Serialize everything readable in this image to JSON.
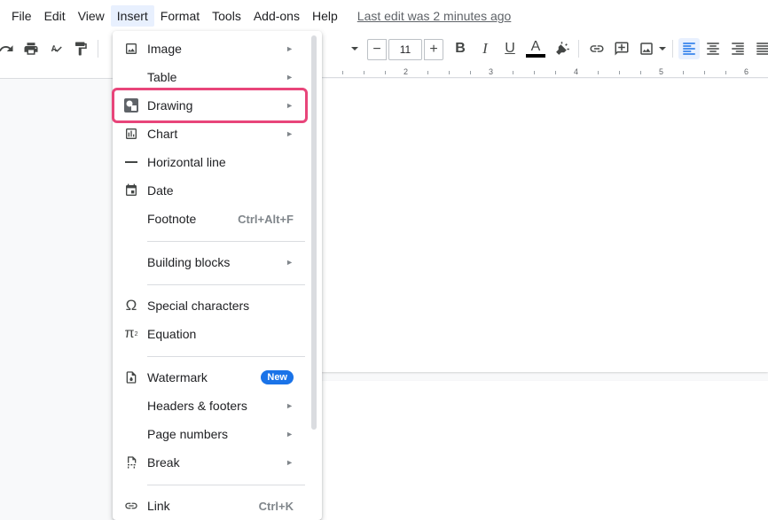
{
  "menubar": {
    "items": [
      "File",
      "Edit",
      "View",
      "Insert",
      "Format",
      "Tools",
      "Add-ons",
      "Help"
    ],
    "active_index": 3,
    "last_edit": "Last edit was 2 minutes ago"
  },
  "toolbar": {
    "font_size": "11",
    "minus_label": "−",
    "plus_label": "+",
    "bold_label": "B",
    "italic_label": "I",
    "underline_label": "U",
    "text_color_label": "A",
    "text_color": "#000000",
    "align_active_color": "#1a73e8"
  },
  "ruler": {
    "labels": [
      "2",
      "3",
      "4",
      "5",
      "6"
    ]
  },
  "insert_menu": {
    "items": [
      {
        "label": "Image",
        "icon": "image-icon",
        "submenu": true
      },
      {
        "label": "Table",
        "icon": "",
        "submenu": true
      },
      {
        "label": "Drawing",
        "icon": "drawing-icon",
        "submenu": true
      },
      {
        "label": "Chart",
        "icon": "chart-icon",
        "submenu": true
      },
      {
        "label": "Horizontal line",
        "icon": "horizontal-line-icon",
        "submenu": false
      },
      {
        "label": "Date",
        "icon": "calendar-icon",
        "submenu": false
      },
      {
        "label": "Footnote",
        "icon": "",
        "shortcut": "Ctrl+Alt+F"
      },
      {
        "label": "Building blocks",
        "icon": "",
        "submenu": true
      },
      {
        "label": "Special characters",
        "icon": "omega-icon",
        "submenu": false
      },
      {
        "label": "Equation",
        "icon": "pi-icon",
        "submenu": false
      },
      {
        "label": "Watermark",
        "icon": "watermark-icon",
        "badge": "New"
      },
      {
        "label": "Headers & footers",
        "icon": "",
        "submenu": true
      },
      {
        "label": "Page numbers",
        "icon": "",
        "submenu": true
      },
      {
        "label": "Break",
        "icon": "break-icon",
        "submenu": true
      },
      {
        "label": "Link",
        "icon": "link-icon",
        "shortcut": "Ctrl+K"
      }
    ],
    "highlighted": "Drawing",
    "highlight_color": "#e8457a",
    "badge_color": "#1a73e8"
  }
}
